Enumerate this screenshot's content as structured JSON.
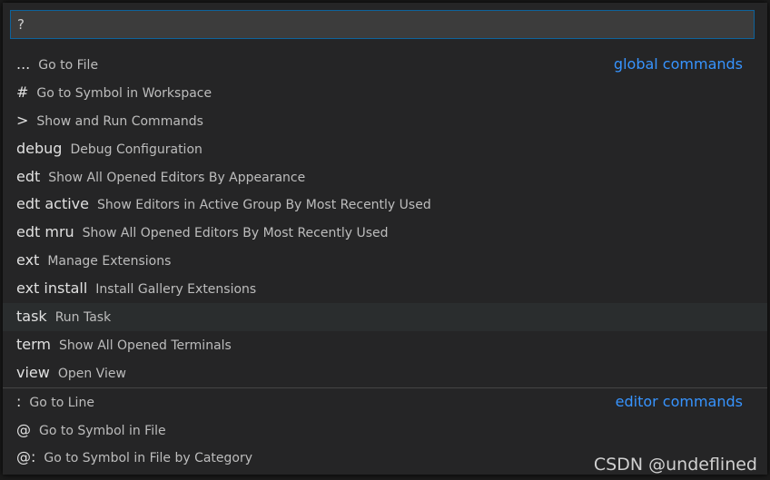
{
  "input": {
    "value": "?"
  },
  "items": [
    {
      "prefix": "...",
      "label": "Go to File",
      "group": "global commands"
    },
    {
      "prefix": "#",
      "label": "Go to Symbol in Workspace"
    },
    {
      "prefix": ">",
      "label": "Show and Run Commands"
    },
    {
      "prefix": "debug",
      "label": "Debug Configuration"
    },
    {
      "prefix": "edt",
      "label": "Show All Opened Editors By Appearance"
    },
    {
      "prefix": "edt active",
      "label": "Show Editors in Active Group By Most Recently Used"
    },
    {
      "prefix": "edt mru",
      "label": "Show All Opened Editors By Most Recently Used"
    },
    {
      "prefix": "ext",
      "label": "Manage Extensions"
    },
    {
      "prefix": "ext install",
      "label": "Install Gallery Extensions"
    },
    {
      "prefix": "task",
      "label": "Run Task",
      "selected": true
    },
    {
      "prefix": "term",
      "label": "Show All Opened Terminals"
    },
    {
      "prefix": "view",
      "label": "Open View"
    },
    {
      "prefix": ":",
      "label": "Go to Line",
      "group": "editor commands",
      "divider": true
    },
    {
      "prefix": "@",
      "label": "Go to Symbol in File"
    },
    {
      "prefix": "@:",
      "label": "Go to Symbol in File by Category"
    }
  ],
  "watermark": "CSDN @undeflined",
  "colors": {
    "accent": "#3794ff",
    "input_border": "#0e639c",
    "background": "#252526",
    "selected_row": "#2a2d2e"
  }
}
